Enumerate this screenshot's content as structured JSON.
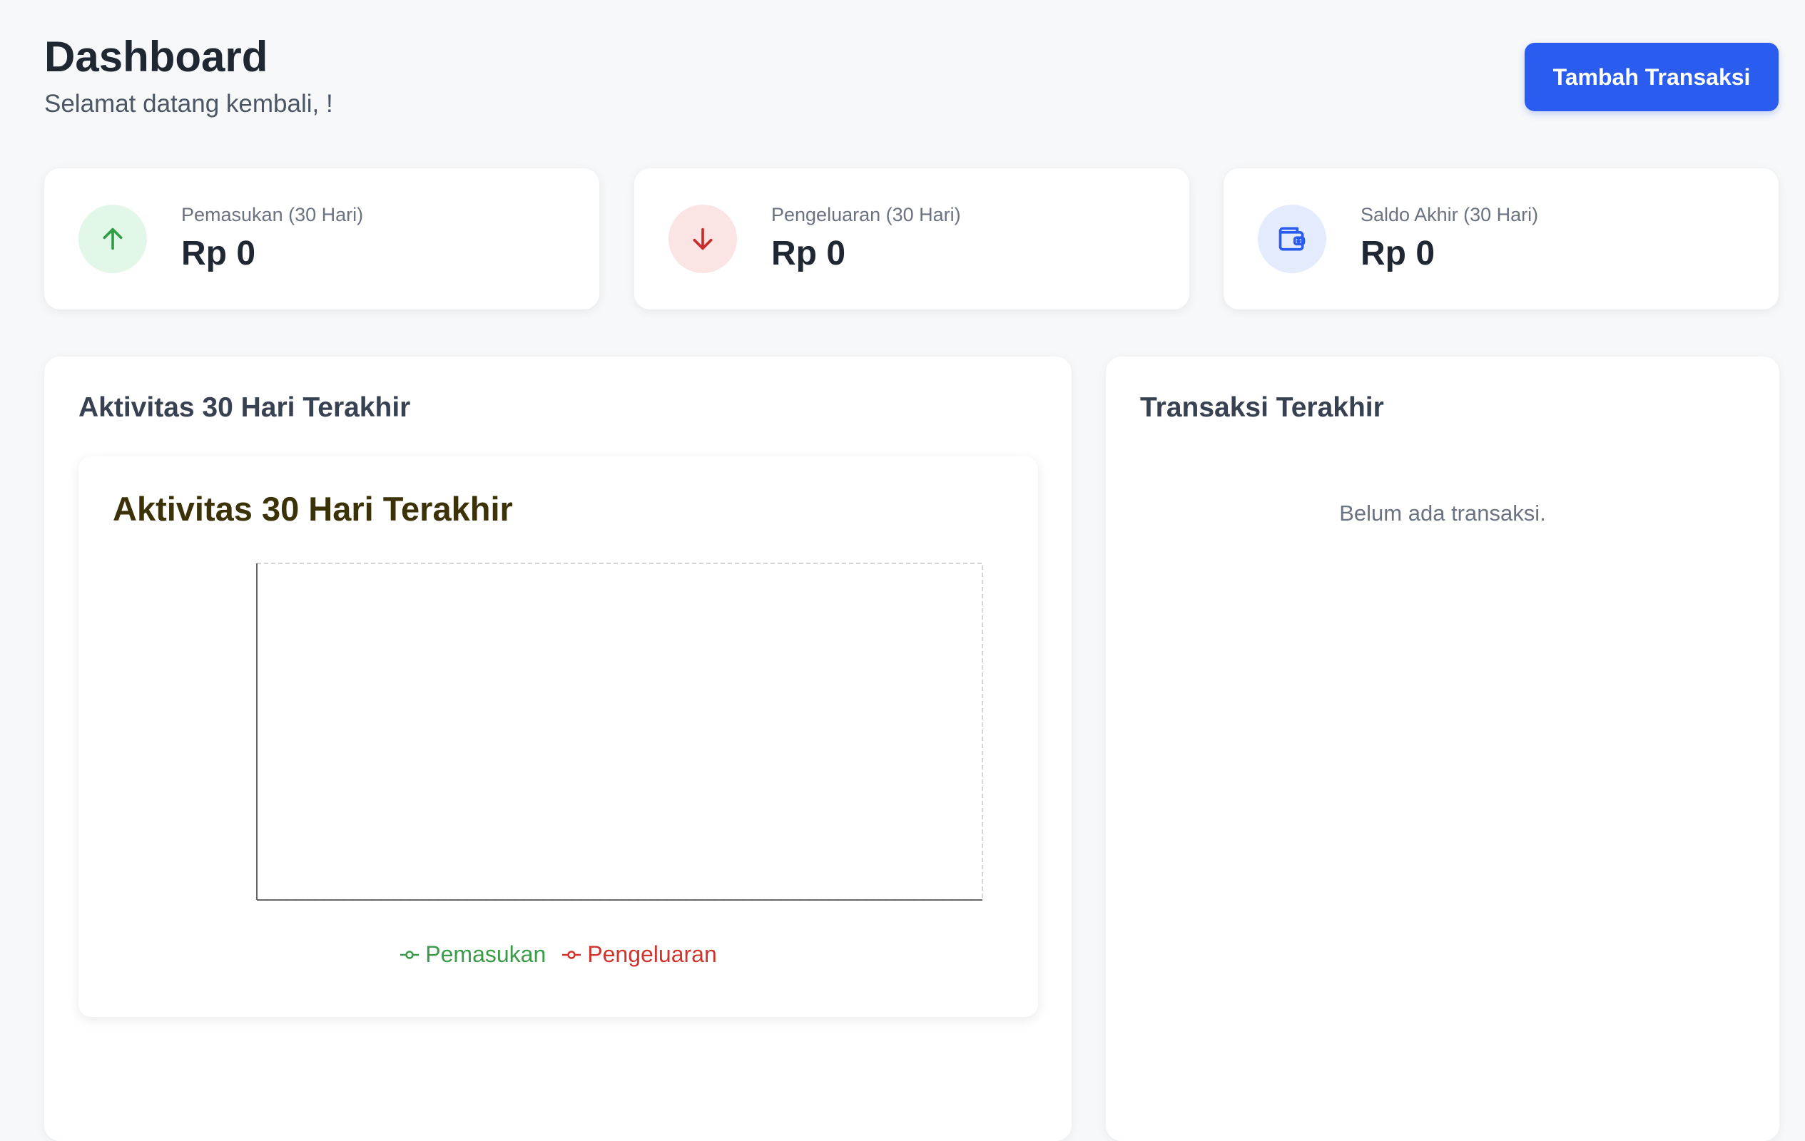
{
  "header": {
    "title": "Dashboard",
    "subtitle": "Selamat datang kembali, !",
    "add_button_label": "Tambah Transaksi"
  },
  "stats": [
    {
      "label": "Pemasukan (30 Hari)",
      "value": "Rp 0",
      "icon": "arrow-up-icon",
      "color": "#2f9e44",
      "bg": "#e3f7e8"
    },
    {
      "label": "Pengeluaran (30 Hari)",
      "value": "Rp 0",
      "icon": "arrow-down-icon",
      "color": "#c92a2a",
      "bg": "#fbe4e4"
    },
    {
      "label": "Saldo Akhir (30 Hari)",
      "value": "Rp 0",
      "icon": "wallet-icon",
      "color": "#2b5cf0",
      "bg": "#e3ebfd"
    }
  ],
  "activity": {
    "panel_title": "Aktivitas 30 Hari Terakhir"
  },
  "chart_data": {
    "type": "line",
    "title": "Aktivitas 30 Hari Terakhir",
    "x": [],
    "series": [
      {
        "name": "Pemasukan",
        "values": [],
        "color": "#3a9b48"
      },
      {
        "name": "Pengeluaran",
        "values": [],
        "color": "#d0342c"
      }
    ],
    "xlabel": "",
    "ylabel": "",
    "grid": false,
    "legend": "bottom"
  },
  "transactions": {
    "panel_title": "Transaksi Terakhir",
    "empty_text": "Belum ada transaksi."
  }
}
